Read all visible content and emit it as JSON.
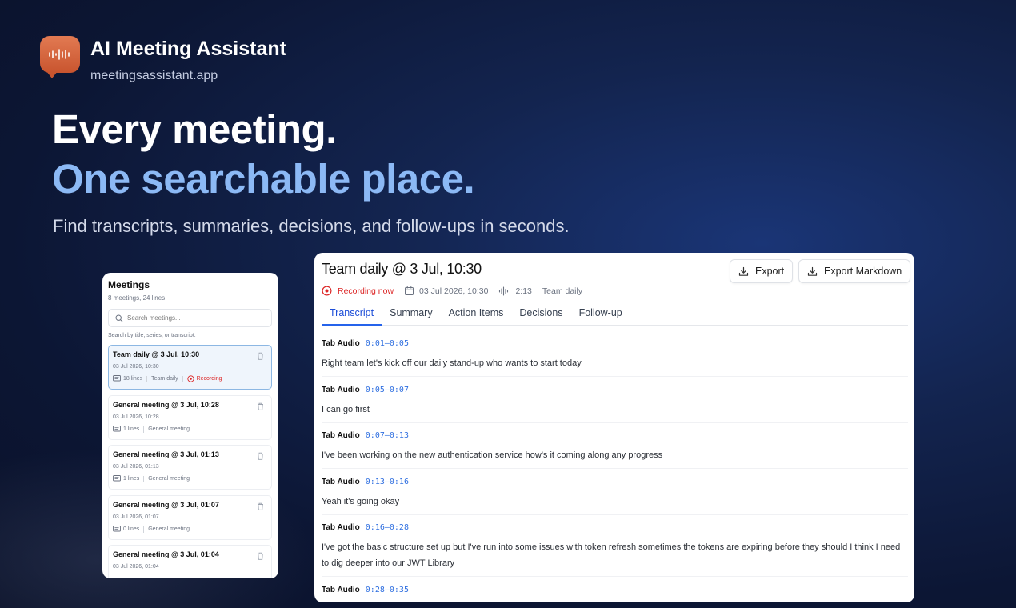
{
  "brand": {
    "title": "AI Meeting Assistant",
    "url": "meetingsassistant.app",
    "logo_icon": "audio-waveform-speech-bubble-icon",
    "logo_color": "#d8683f"
  },
  "hero": {
    "line1": "Every meeting.",
    "line2": "One searchable place.",
    "subtitle": "Find transcripts, summaries, decisions, and follow-ups in seconds."
  },
  "sidebar": {
    "title": "Meetings",
    "subtitle": "8 meetings, 24 lines",
    "search_placeholder": "Search meetings...",
    "search_hint": "Search by title, series, or transcript.",
    "items": [
      {
        "title": "Team daily @ 3 Jul, 10:30",
        "date": "03 Jul 2026, 10:30",
        "lines": "18 lines",
        "series": "Team daily",
        "status": "Recording"
      },
      {
        "title": "General meeting @ 3 Jul, 10:28",
        "date": "03 Jul 2026, 10:28",
        "lines": "1 lines",
        "series": "General meeting"
      },
      {
        "title": "General meeting @ 3 Jul, 01:13",
        "date": "03 Jul 2026, 01:13",
        "lines": "1 lines",
        "series": "General meeting"
      },
      {
        "title": "General meeting @ 3 Jul, 01:07",
        "date": "03 Jul 2026, 01:07",
        "lines": "0 lines",
        "series": "General meeting"
      },
      {
        "title": "General meeting @ 3 Jul, 01:04",
        "date": "03 Jul 2026, 01:04"
      }
    ]
  },
  "meeting": {
    "title": "Team daily @ 3 Jul, 10:30",
    "export_label": "Export",
    "export_markdown_label": "Export Markdown",
    "status": "Recording now",
    "date": "03 Jul 2026, 10:30",
    "duration": "2:13",
    "series": "Team daily",
    "tabs": [
      "Transcript",
      "Summary",
      "Action Items",
      "Decisions",
      "Follow-up"
    ],
    "active_tab": "Transcript",
    "transcript": [
      {
        "speaker": "Tab Audio",
        "time": "0:01–0:05",
        "text": "Right team let's kick off our daily stand-up who wants to start today"
      },
      {
        "speaker": "Tab Audio",
        "time": "0:05–0:07",
        "text": "I can go first"
      },
      {
        "speaker": "Tab Audio",
        "time": "0:07–0:13",
        "text": "I've been working on the new authentication service how's it coming along any progress"
      },
      {
        "speaker": "Tab Audio",
        "time": "0:13–0:16",
        "text": "Yeah it's going okay"
      },
      {
        "speaker": "Tab Audio",
        "time": "0:16–0:28",
        "text": "I've got the basic structure set up but I've run into some issues with token refresh sometimes the tokens are expiring before they should I think I need to dig deeper into our JWT Library"
      },
      {
        "speaker": "Tab Audio",
        "time": "0:28–0:35",
        "text": ""
      }
    ]
  },
  "colors": {
    "accent": "#2563eb",
    "recording": "#dc2626",
    "hero_highlight": "#8cb9f5"
  }
}
